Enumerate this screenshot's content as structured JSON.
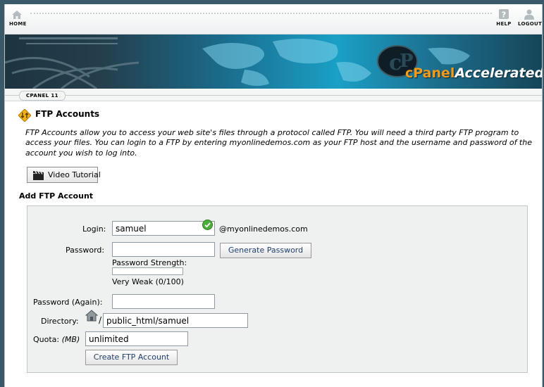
{
  "nav": {
    "home_label": "HOME",
    "help_label": "HELP",
    "logout_label": "LOGOUT"
  },
  "banner": {
    "brand_prefix": "cPanel",
    "brand_suffix": "Accelerated",
    "logo_icon": "cpanel-logo-icon"
  },
  "version_tab": "CPANEL 11",
  "page": {
    "title": "FTP Accounts",
    "description": "FTP Accounts allow you to access your web site's files through a protocol called FTP. You will need a third party FTP program to access your files. You can login to a FTP by entering myonlinedemos.com as your FTP host and the username and password of the account you wish to log into.",
    "video_button": "Video Tutorial"
  },
  "form": {
    "section_title": "Add FTP Account",
    "login_label": "Login:",
    "login_value": "samuel",
    "domain_suffix": "@myonlinedemos.com",
    "password_label": "Password:",
    "password_value": "",
    "generate_button": "Generate Password",
    "strength_label": "Password Strength:",
    "strength_value": "Very Weak (0/100)",
    "strength_score": 0,
    "password_again_label": "Password (Again):",
    "password_again_value": "",
    "directory_label": "Directory:",
    "directory_prefix": "/",
    "directory_value": "public_html/samuel",
    "quota_label": "Quota:",
    "quota_unit": "(MB)",
    "quota_value": "unlimited",
    "create_button": "Create FTP Account"
  },
  "colors": {
    "accent_orange": "#f39a1a",
    "banner_blue": "#1aa0c6",
    "valid_green": "#4cae3a",
    "button_text": "#1d3f6b"
  }
}
